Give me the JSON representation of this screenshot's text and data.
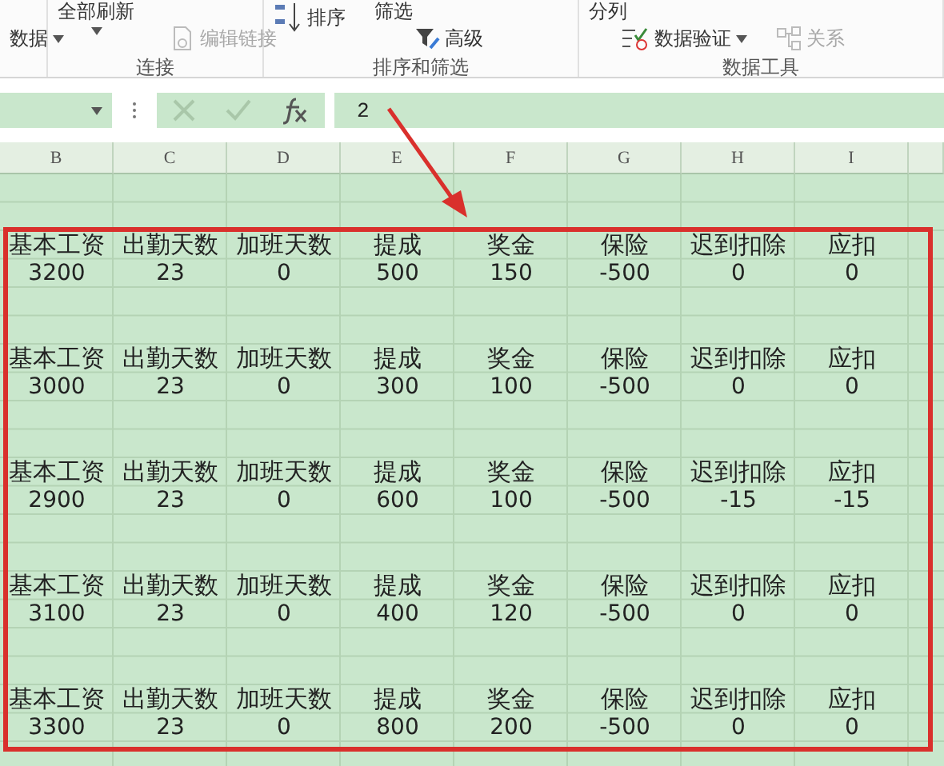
{
  "ribbon": {
    "groups": [
      {
        "commands": [
          {
            "label": "数据",
            "kind": "small",
            "dropdown": true,
            "disabled": false
          }
        ]
      },
      {
        "label": "连接",
        "commands": [
          {
            "label": "全部刷新",
            "kind": "large",
            "dropdown": true,
            "disabled": false
          },
          {
            "label": "编辑链接",
            "kind": "small",
            "dropdown": false,
            "disabled": true
          }
        ]
      },
      {
        "label": "排序和筛选",
        "commands": [
          {
            "label": "排序",
            "kind": "large",
            "dropdown": false,
            "disabled": false
          },
          {
            "label": "筛选",
            "kind": "large",
            "dropdown": false,
            "disabled": false
          },
          {
            "label": "高级",
            "kind": "small",
            "dropdown": false,
            "disabled": false
          }
        ]
      },
      {
        "label": "数据工具",
        "commands": [
          {
            "label": "分列",
            "kind": "large",
            "dropdown": false,
            "disabled": false
          },
          {
            "label": "数据验证",
            "kind": "small",
            "dropdown": true,
            "disabled": false
          },
          {
            "label": "关系",
            "kind": "small",
            "dropdown": false,
            "disabled": true
          }
        ]
      }
    ]
  },
  "formula_bar": {
    "value": "2"
  },
  "sheet": {
    "columns": [
      "B",
      "C",
      "D",
      "E",
      "F",
      "G",
      "H",
      "I"
    ],
    "records": [
      {
        "headers": [
          "基本工资",
          "出勤天数",
          "加班天数",
          "提成",
          "奖金",
          "保险",
          "迟到扣除",
          "应扣"
        ],
        "values": [
          "3200",
          "23",
          "0",
          "500",
          "150",
          "-500",
          "0",
          "0"
        ]
      },
      {
        "headers": [
          "基本工资",
          "出勤天数",
          "加班天数",
          "提成",
          "奖金",
          "保险",
          "迟到扣除",
          "应扣"
        ],
        "values": [
          "3000",
          "23",
          "0",
          "300",
          "100",
          "-500",
          "0",
          "0"
        ]
      },
      {
        "headers": [
          "基本工资",
          "出勤天数",
          "加班天数",
          "提成",
          "奖金",
          "保险",
          "迟到扣除",
          "应扣"
        ],
        "values": [
          "2900",
          "23",
          "0",
          "600",
          "100",
          "-500",
          "-15",
          "-15"
        ]
      },
      {
        "headers": [
          "基本工资",
          "出勤天数",
          "加班天数",
          "提成",
          "奖金",
          "保险",
          "迟到扣除",
          "应扣"
        ],
        "values": [
          "3100",
          "23",
          "0",
          "400",
          "120",
          "-500",
          "0",
          "0"
        ]
      },
      {
        "headers": [
          "基本工资",
          "出勤天数",
          "加班天数",
          "提成",
          "奖金",
          "保险",
          "迟到扣除",
          "应扣"
        ],
        "values": [
          "3300",
          "23",
          "0",
          "800",
          "200",
          "-500",
          "0",
          "0"
        ]
      }
    ]
  }
}
